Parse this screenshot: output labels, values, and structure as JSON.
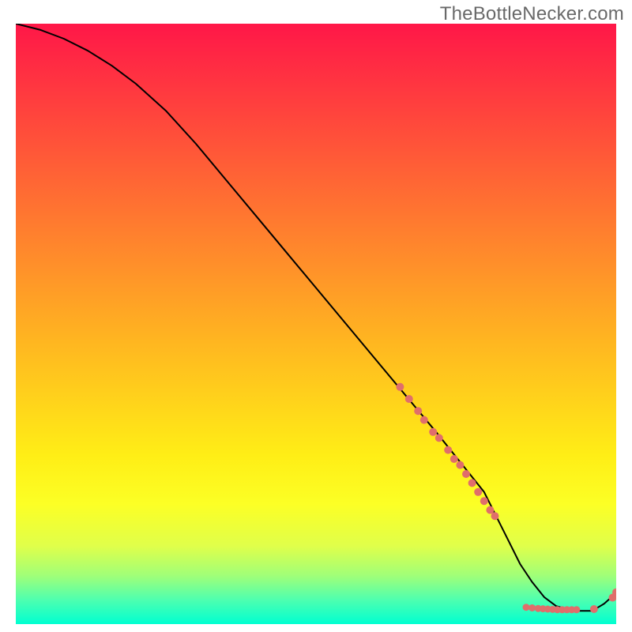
{
  "watermark": "TheBottleNecker.com",
  "colors": {
    "gradient_stops": [
      {
        "offset": 0.0,
        "color": "#ff1748"
      },
      {
        "offset": 0.52,
        "color": "#ffb321"
      },
      {
        "offset": 0.72,
        "color": "#ffee16"
      },
      {
        "offset": 0.8,
        "color": "#fcff25"
      },
      {
        "offset": 0.87,
        "color": "#e0ff4a"
      },
      {
        "offset": 0.92,
        "color": "#9fff79"
      },
      {
        "offset": 0.96,
        "color": "#4dffb0"
      },
      {
        "offset": 1.0,
        "color": "#00ffd1"
      }
    ],
    "line": "#000000",
    "marker": "#e06e6b"
  },
  "chart_data": {
    "type": "line",
    "title": "",
    "xlabel": "",
    "ylabel": "",
    "xlim": [
      0,
      100
    ],
    "ylim": [
      0,
      100
    ],
    "series": [
      {
        "name": "curve",
        "x": [
          0,
          4,
          8,
          12,
          16,
          20,
          25,
          30,
          35,
          40,
          45,
          50,
          55,
          60,
          65,
          70,
          74,
          78,
          80,
          82,
          84,
          86,
          88,
          90,
          93,
          96,
          98,
          100
        ],
        "y": [
          100,
          99,
          97.5,
          95.5,
          93,
          90,
          85.5,
          80,
          74,
          68,
          62,
          56,
          50,
          44,
          38,
          32,
          27,
          22,
          18,
          14,
          10,
          7,
          4.5,
          3,
          2.2,
          2.2,
          3.4,
          5.2
        ]
      }
    ],
    "markers": {
      "cluster_a": {
        "x": [
          64,
          65.5,
          67,
          68,
          69.5,
          70.5,
          72,
          73,
          74,
          75,
          76,
          77,
          78,
          79,
          79.8
        ],
        "y": [
          39.5,
          37.5,
          35.5,
          34,
          32,
          31,
          29,
          27.5,
          26.5,
          25,
          23.5,
          22,
          20.5,
          19,
          18
        ],
        "r": 5
      },
      "cluster_b": {
        "x": [
          85,
          86,
          87,
          87.8,
          88.6,
          89.4,
          90.2,
          91,
          91.8,
          92.6,
          93.4
        ],
        "y": [
          2.8,
          2.7,
          2.6,
          2.55,
          2.5,
          2.45,
          2.4,
          2.4,
          2.4,
          2.4,
          2.4
        ],
        "r": 4.5
      },
      "point_c": {
        "x": [
          96.3
        ],
        "y": [
          2.5
        ],
        "r": 5
      },
      "pair_d": {
        "x": [
          99.4,
          100
        ],
        "y": [
          4.4,
          5.3
        ],
        "r": 5
      }
    }
  }
}
